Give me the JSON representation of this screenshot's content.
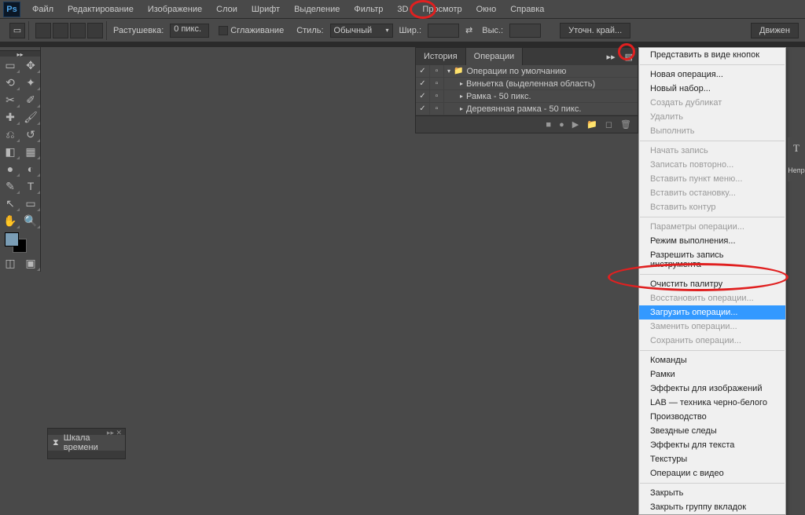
{
  "menubar": {
    "items": [
      "Файл",
      "Редактирование",
      "Изображение",
      "Слои",
      "Шрифт",
      "Выделение",
      "Фильтр",
      "3D",
      "Просмотр",
      "Окно",
      "Справка"
    ]
  },
  "optbar": {
    "feather_label": "Растушевка:",
    "feather_value": "0 пикс.",
    "antialias_label": "Сглаживание",
    "style_label": "Стиль:",
    "style_value": "Обычный",
    "width_label": "Шир.:",
    "height_label": "Выс.:",
    "refine_label": "Уточн. край...",
    "motion_label": "Движен"
  },
  "panel": {
    "tab_history": "История",
    "tab_actions": "Операции",
    "set_default": "Операции по умолчанию",
    "action_1": "Виньетка (выделенная область)",
    "action_2": "Рамка - 50 пикс.",
    "action_3": "Деревянная рамка - 50 пикс."
  },
  "ctx": {
    "button_mode": "Представить в виде кнопок",
    "new_action": "Новая операция...",
    "new_set": "Новый набор...",
    "duplicate": "Создать дубликат",
    "delete": "Удалить",
    "play": "Выполнить",
    "start_rec": "Начать запись",
    "record_again": "Записать повторно...",
    "insert_menu": "Вставить пункт меню...",
    "insert_stop": "Вставить остановку...",
    "insert_path": "Вставить контур",
    "action_options": "Параметры операции...",
    "playback_options": "Режим выполнения...",
    "allow_tool_rec": "Разрешить запись инструмента",
    "clear_actions": "Очистить палитру",
    "reset_actions": "Восстановить операции...",
    "load_actions": "Загрузить операции...",
    "replace_actions": "Заменить операции...",
    "save_actions": "Сохранить операции...",
    "commands": "Команды",
    "frames": "Рамки",
    "image_effects": "Эффекты для изображений",
    "lab": "LAB — техника черно-белого",
    "production": "Производство",
    "star_trails": "Звездные следы",
    "text_effects": "Эффекты для текста",
    "textures": "Текстуры",
    "video_actions": "Операции с видео",
    "close": "Закрыть",
    "close_group": "Закрыть группу вкладок"
  },
  "timeline": {
    "label": "Шкала времени"
  },
  "rightstub": {
    "nepro": "Непр"
  }
}
